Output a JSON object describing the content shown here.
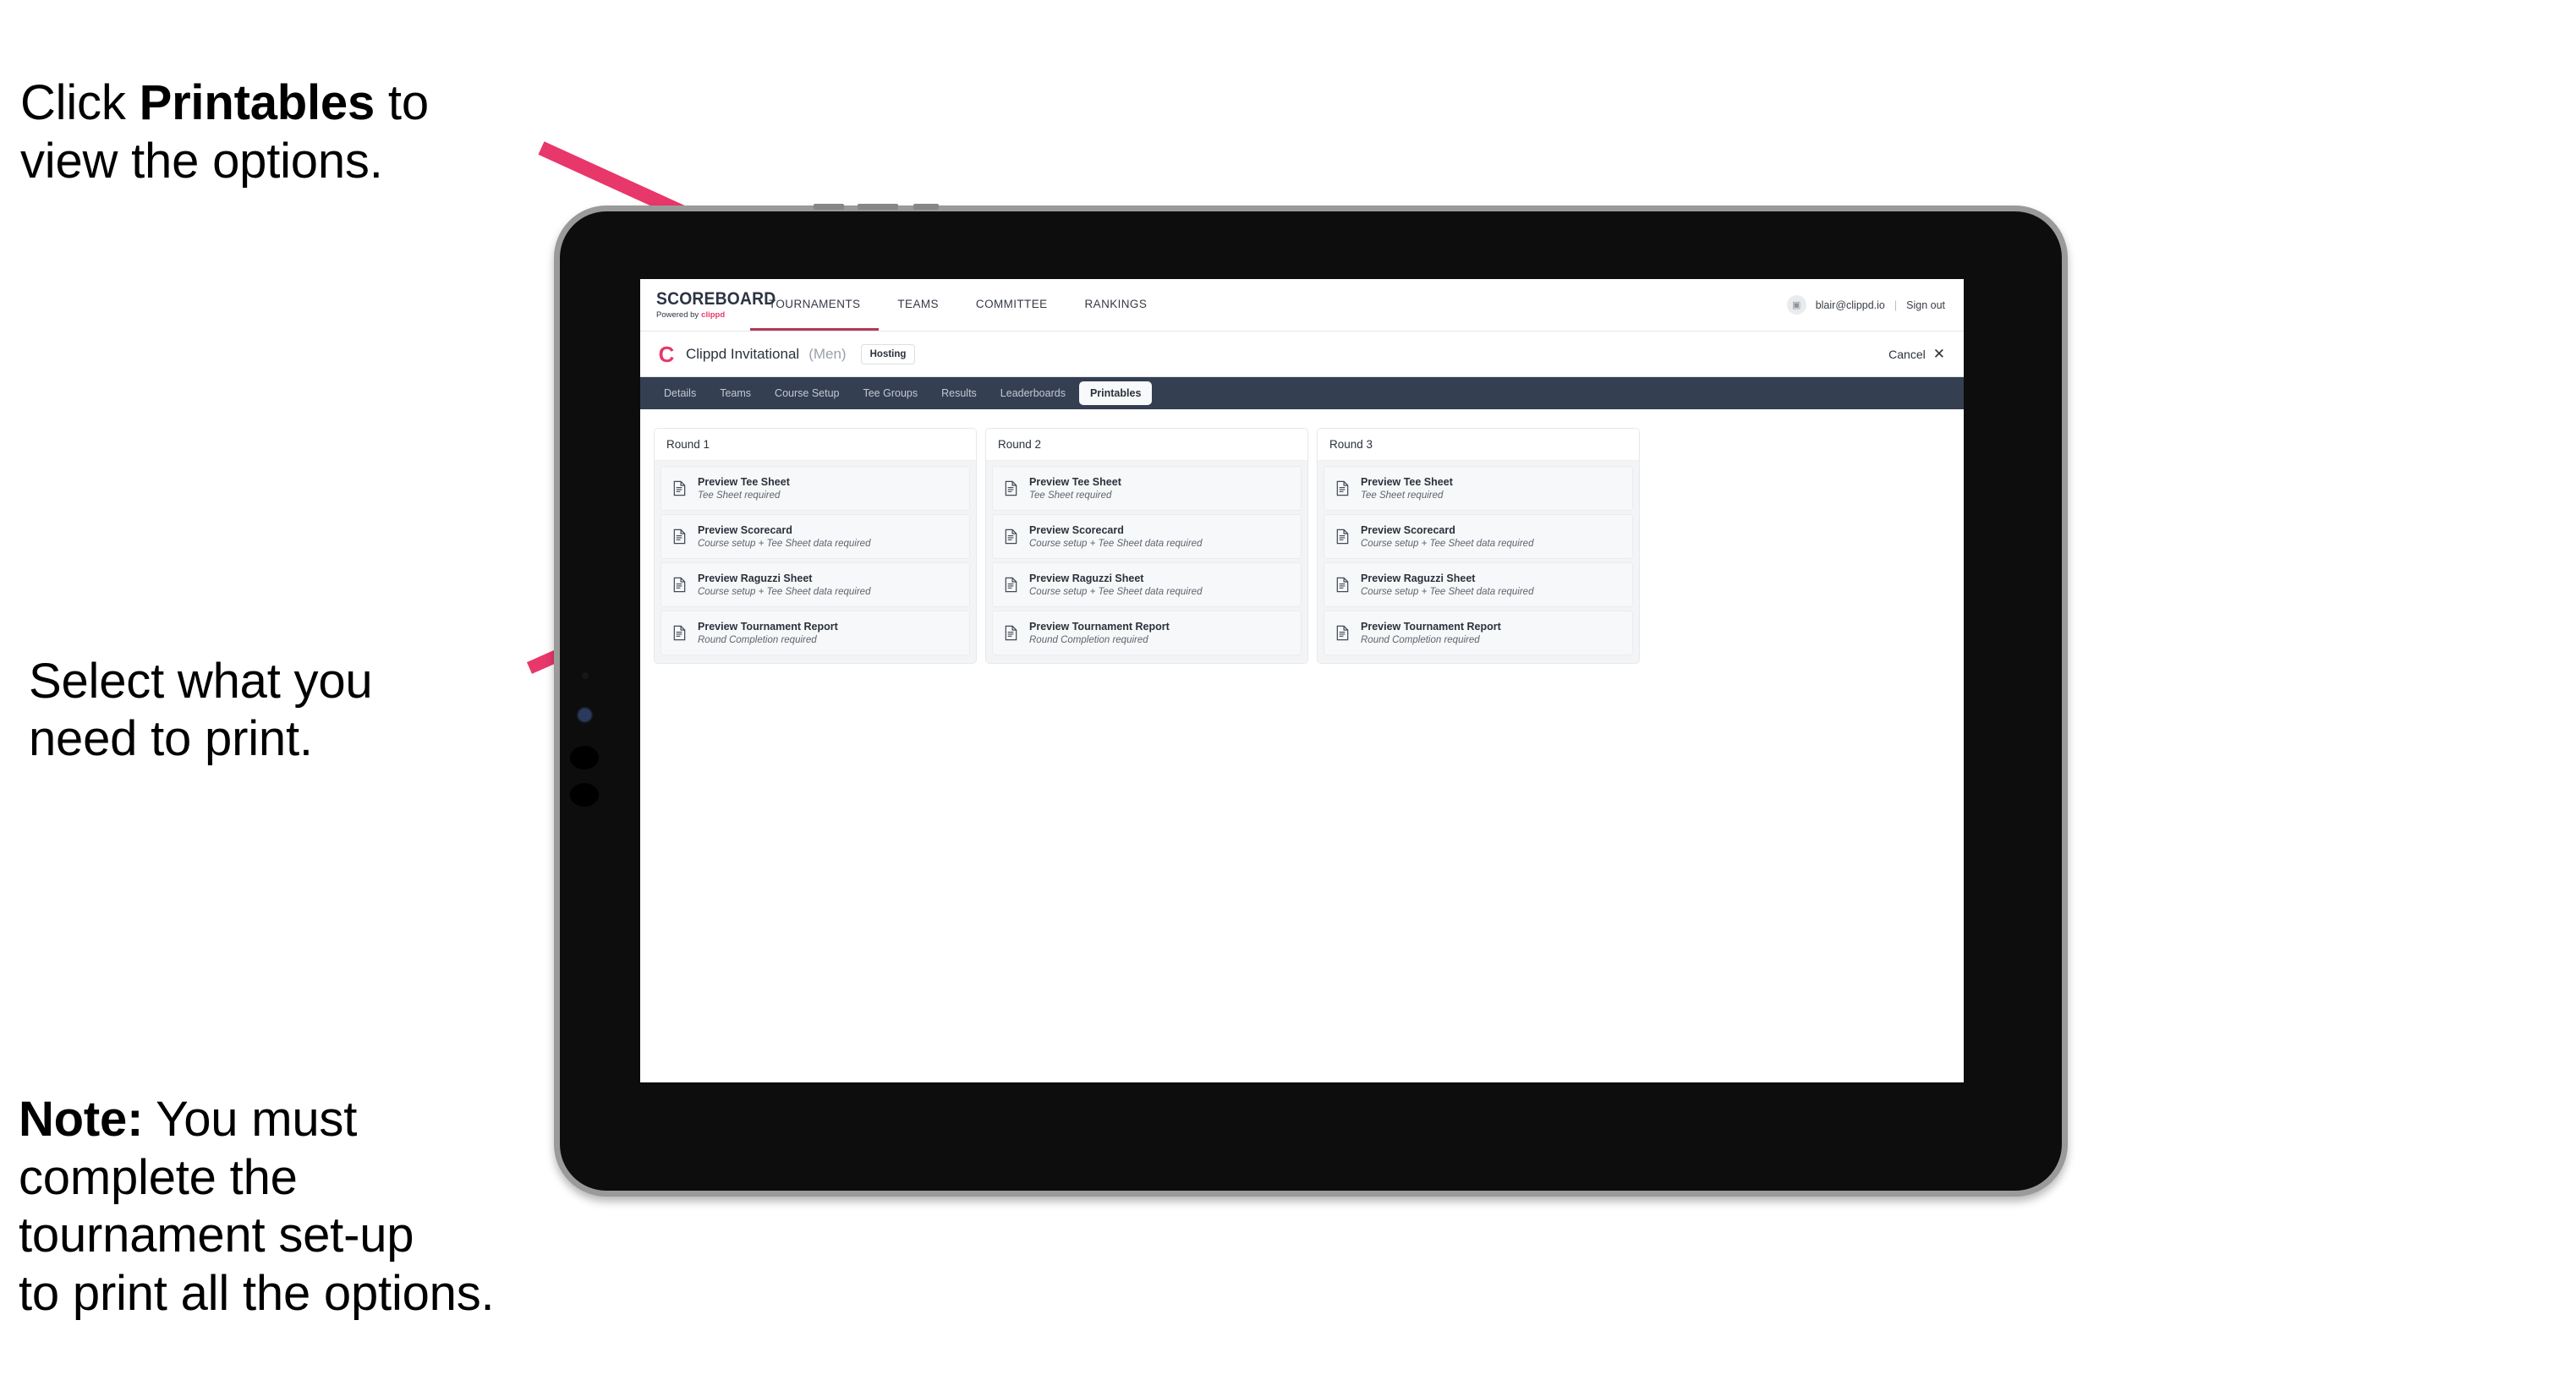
{
  "annotations": {
    "top": {
      "prefix": "Click ",
      "bold": "Printables",
      "suffix": " to\nview the options."
    },
    "middle": {
      "text": "Select what you\n need to print."
    },
    "note": {
      "bold": "Note:",
      "text": " You must\ncomplete the\ntournament set-up\nto print all the options."
    }
  },
  "app": {
    "brand": {
      "wordmark": "SCOREBOARD",
      "powered_by": "Powered by",
      "company": "clippd"
    },
    "main_nav": [
      {
        "label": "TOURNAMENTS",
        "active": true
      },
      {
        "label": "TEAMS",
        "active": false
      },
      {
        "label": "COMMITTEE",
        "active": false
      },
      {
        "label": "RANKINGS",
        "active": false
      }
    ],
    "user": {
      "avatar_icon": "user-avatar-icon",
      "email": "blair@clippd.io",
      "separator": "|",
      "sign_out": "Sign out"
    },
    "event": {
      "logo_letter": "C",
      "title": "Clippd Invitational",
      "gender": "(Men)",
      "badge": "Hosting",
      "cancel": "Cancel",
      "cancel_icon": "close-x-icon"
    },
    "tabs": [
      {
        "label": "Details",
        "active": false
      },
      {
        "label": "Teams",
        "active": false
      },
      {
        "label": "Course Setup",
        "active": false
      },
      {
        "label": "Tee Groups",
        "active": false
      },
      {
        "label": "Results",
        "active": false
      },
      {
        "label": "Leaderboards",
        "active": false
      },
      {
        "label": "Printables",
        "active": true
      }
    ],
    "rounds": [
      {
        "header": "Round 1",
        "items": [
          {
            "title": "Preview Tee Sheet",
            "sub": "Tee Sheet required"
          },
          {
            "title": "Preview Scorecard",
            "sub": "Course setup + Tee Sheet data required"
          },
          {
            "title": "Preview Raguzzi Sheet",
            "sub": "Course setup + Tee Sheet data required"
          },
          {
            "title": "Preview Tournament Report",
            "sub": "Round Completion required"
          }
        ]
      },
      {
        "header": "Round 2",
        "items": [
          {
            "title": "Preview Tee Sheet",
            "sub": "Tee Sheet required"
          },
          {
            "title": "Preview Scorecard",
            "sub": "Course setup + Tee Sheet data required"
          },
          {
            "title": "Preview Raguzzi Sheet",
            "sub": "Course setup + Tee Sheet data required"
          },
          {
            "title": "Preview Tournament Report",
            "sub": "Round Completion required"
          }
        ]
      },
      {
        "header": "Round 3",
        "items": [
          {
            "title": "Preview Tee Sheet",
            "sub": "Tee Sheet required"
          },
          {
            "title": "Preview Scorecard",
            "sub": "Course setup + Tee Sheet data required"
          },
          {
            "title": "Preview Raguzzi Sheet",
            "sub": "Course setup + Tee Sheet data required"
          },
          {
            "title": "Preview Tournament Report",
            "sub": "Round Completion required"
          }
        ]
      }
    ]
  },
  "colors": {
    "accent_pink": "#e8376a",
    "tabbar_navy": "#343f52",
    "nav_active_underline": "#b33a52",
    "card_bg": "#f7f8f9",
    "board_bg": "#f3f4f6",
    "bezel_black": "#0d0d0d",
    "bezel_edge": "#9a9a9a"
  }
}
